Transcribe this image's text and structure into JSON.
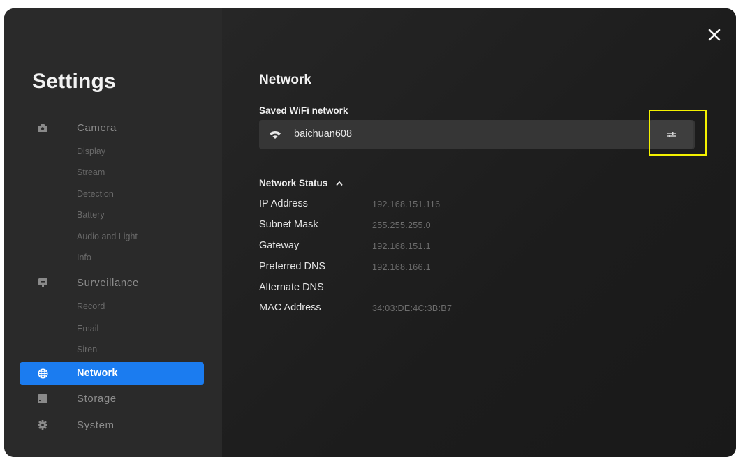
{
  "sidebar": {
    "title": "Settings",
    "groups": [
      {
        "label": "Camera",
        "icon": "camera-icon",
        "subs": [
          "Display",
          "Stream",
          "Detection",
          "Battery",
          "Audio and Light",
          "Info"
        ]
      },
      {
        "label": "Surveillance",
        "icon": "monitor-icon",
        "subs": [
          "Record",
          "Email",
          "Siren"
        ]
      },
      {
        "label": "Network",
        "icon": "globe-icon",
        "active": true
      },
      {
        "label": "Storage",
        "icon": "storage-icon"
      },
      {
        "label": "System",
        "icon": "gear-icon"
      }
    ]
  },
  "main": {
    "title": "Network",
    "saved_wifi_label": "Saved WiFi network",
    "ssid": "baichuan608",
    "status_label": "Network Status",
    "status": [
      {
        "key": "IP Address",
        "value": "192.168.151.116"
      },
      {
        "key": "Subnet Mask",
        "value": "255.255.255.0"
      },
      {
        "key": "Gateway",
        "value": "192.168.151.1"
      },
      {
        "key": "Preferred DNS",
        "value": "192.168.166.1"
      },
      {
        "key": "Alternate DNS",
        "value": ""
      },
      {
        "key": "MAC Address",
        "value": "34:03:DE:4C:3B:B7"
      }
    ]
  },
  "colors": {
    "accent": "#1b7cf0",
    "highlight": "#f3f100",
    "sidebar_bg": "#2a2a2a",
    "main_bg": "#1d1d1d"
  }
}
